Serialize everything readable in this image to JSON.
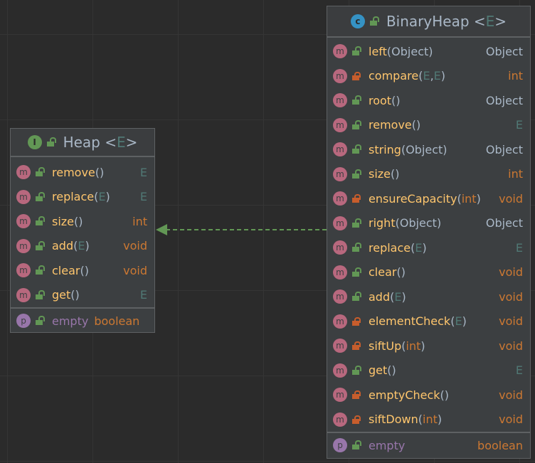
{
  "colors": {
    "method_name": "#ffc66d",
    "generic": "#507874",
    "keyword_type": "#cc7832",
    "class_type": "#a9b7c6",
    "property": "#9876aa",
    "arrow": "#629755",
    "public": "#629755",
    "private": "#c75d2c"
  },
  "arrow": {
    "type": "realization",
    "from": "BinaryHeap",
    "to": "Heap"
  },
  "heap": {
    "kind": "interface",
    "kind_letter": "I",
    "name": "Heap",
    "generic": "E",
    "methods": [
      {
        "name": "remove",
        "params": [],
        "ret": "E",
        "access": "public"
      },
      {
        "name": "replace",
        "params": [
          "E"
        ],
        "ret": "E",
        "access": "public"
      },
      {
        "name": "size",
        "params": [],
        "ret": "int",
        "access": "public"
      },
      {
        "name": "add",
        "params": [
          "E"
        ],
        "ret": "void",
        "access": "public"
      },
      {
        "name": "clear",
        "params": [],
        "ret": "void",
        "access": "public"
      },
      {
        "name": "get",
        "params": [],
        "ret": "E",
        "access": "public"
      }
    ],
    "properties": [
      {
        "letter": "p",
        "name": "empty",
        "type": "boolean",
        "access": "public"
      }
    ]
  },
  "binaryheap": {
    "kind": "class",
    "kind_letter": "c",
    "name": "BinaryHeap",
    "generic": "E",
    "methods": [
      {
        "name": "left",
        "params": [
          "Object"
        ],
        "ret": "Object",
        "access": "public"
      },
      {
        "name": "compare",
        "params": [
          "E",
          "E"
        ],
        "ret": "int",
        "access": "private"
      },
      {
        "name": "root",
        "params": [],
        "ret": "Object",
        "access": "public"
      },
      {
        "name": "remove",
        "params": [],
        "ret": "E",
        "access": "public"
      },
      {
        "name": "string",
        "params": [
          "Object"
        ],
        "ret": "Object",
        "access": "public"
      },
      {
        "name": "size",
        "params": [],
        "ret": "int",
        "access": "public"
      },
      {
        "name": "ensureCapacity",
        "params": [
          "int"
        ],
        "ret": "void",
        "access": "private"
      },
      {
        "name": "right",
        "params": [
          "Object"
        ],
        "ret": "Object",
        "access": "public"
      },
      {
        "name": "replace",
        "params": [
          "E"
        ],
        "ret": "E",
        "access": "public"
      },
      {
        "name": "clear",
        "params": [],
        "ret": "void",
        "access": "public"
      },
      {
        "name": "add",
        "params": [
          "E"
        ],
        "ret": "void",
        "access": "public"
      },
      {
        "name": "elementCheck",
        "params": [
          "E"
        ],
        "ret": "void",
        "access": "private"
      },
      {
        "name": "siftUp",
        "params": [
          "int"
        ],
        "ret": "void",
        "access": "private"
      },
      {
        "name": "get",
        "params": [],
        "ret": "E",
        "access": "public"
      },
      {
        "name": "emptyCheck",
        "params": [],
        "ret": "void",
        "access": "private"
      },
      {
        "name": "siftDown",
        "params": [
          "int"
        ],
        "ret": "void",
        "access": "private"
      }
    ],
    "properties": [
      {
        "letter": "p",
        "name": "empty",
        "type": "boolean",
        "access": "public"
      }
    ]
  },
  "method_letter": "m"
}
